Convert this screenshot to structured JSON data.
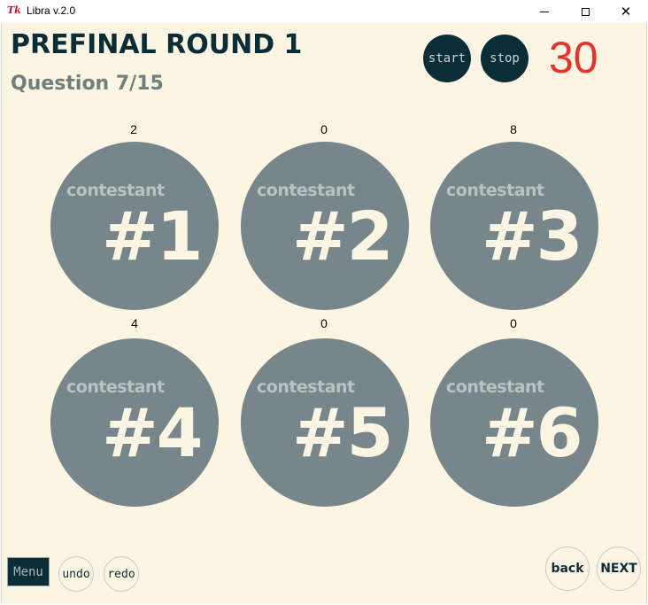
{
  "window": {
    "title": "Libra v.2.0",
    "icon": "tk-icon",
    "icon_text": "Tk"
  },
  "header": {
    "round_title": "PREFINAL ROUND 1",
    "question": "Question 7/15"
  },
  "controls": {
    "start_label": "start",
    "stop_label": "stop",
    "timer": "30",
    "timer_color": "#e5332a"
  },
  "contestants": [
    {
      "label": "contestant",
      "number": "#1",
      "score": "2"
    },
    {
      "label": "contestant",
      "number": "#2",
      "score": "0"
    },
    {
      "label": "contestant",
      "number": "#3",
      "score": "8"
    },
    {
      "label": "contestant",
      "number": "#4",
      "score": "4"
    },
    {
      "label": "contestant",
      "number": "#5",
      "score": "0"
    },
    {
      "label": "contestant",
      "number": "#6",
      "score": "0"
    }
  ],
  "footer": {
    "menu_label": "Menu",
    "undo_label": "undo",
    "redo_label": "redo",
    "back_label": "back",
    "next_label": "NEXT"
  },
  "colors": {
    "background": "#fcf5e3",
    "dark": "#0b2d38",
    "circle": "#77868a",
    "accent": "#e5332a"
  }
}
